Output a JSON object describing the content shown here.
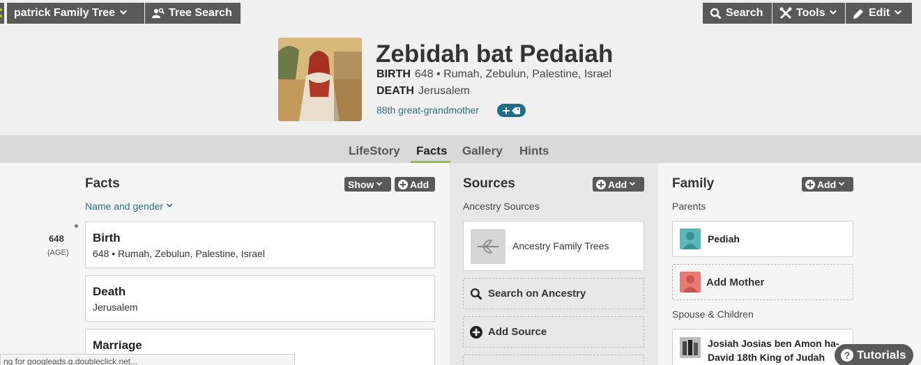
{
  "topbar": {
    "tree_label": "patrick Family Tree",
    "tree_search_label": "Tree Search",
    "search_label": "Search",
    "tools_label": "Tools",
    "edit_label": "Edit"
  },
  "person": {
    "name": "Zebidah bat Pedaiah",
    "birth_label": "BIRTH",
    "birth_value": "648 • Rumah, Zebulun, Palestine, Israel",
    "death_label": "DEATH",
    "death_value": "Jerusalem",
    "relationship": "88th great-grandmother"
  },
  "tabs": [
    {
      "label": "LifeStory"
    },
    {
      "label": "Facts"
    },
    {
      "label": "Gallery"
    },
    {
      "label": "Hints"
    }
  ],
  "facts": {
    "title": "Facts",
    "show_label": "Show",
    "add_label": "Add",
    "name_gender_link": "Name and gender",
    "timeline": {
      "year": "648",
      "age": "(AGE)"
    },
    "items": [
      {
        "title": "Birth",
        "detail": "648 • Rumah, Zebulun, Palestine, Israel"
      },
      {
        "title": "Death",
        "detail": "Jerusalem"
      },
      {
        "title": "Marriage",
        "detail": ""
      }
    ]
  },
  "sources": {
    "title": "Sources",
    "add_label": "Add",
    "subheading": "Ancestry Sources",
    "tree_source": "Ancestry Family Trees",
    "search_action": "Search on Ancestry",
    "add_source_action": "Add Source"
  },
  "family": {
    "title": "Family",
    "add_label": "Add",
    "parents_label": "Parents",
    "father": "Pediah",
    "add_mother": "Add Mother",
    "spouse_children_label": "Spouse & Children",
    "spouse_line1": "Josiah Josias ben Amon ha-",
    "spouse_line2": "David 18th King of Judah"
  },
  "status_bar": "ng for googleads.g.doubleclick.net...",
  "tutorials_label": "Tutorials",
  "colors": {
    "toolbar_bg": "#595959",
    "accent_green": "#9cbe30",
    "link_teal": "#2b6f88",
    "father_avatar": "#5bb8b8",
    "mother_avatar": "#e97a72"
  }
}
